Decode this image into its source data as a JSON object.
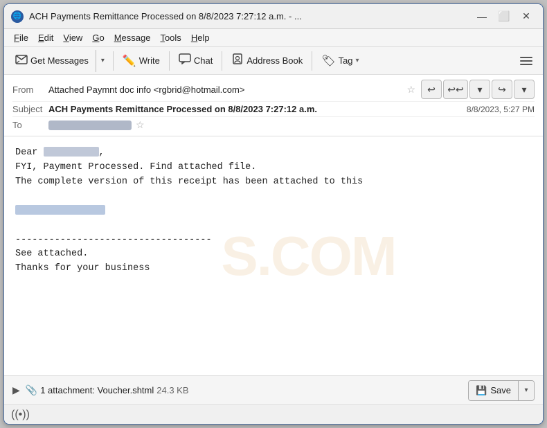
{
  "window": {
    "title": "ACH Payments Remittance Processed on 8/8/2023 7:27:12 a.m. - ...",
    "icon": "🌐"
  },
  "menu": {
    "items": [
      "File",
      "Edit",
      "View",
      "Go",
      "Message",
      "Tools",
      "Help"
    ],
    "underline_chars": [
      "F",
      "E",
      "V",
      "G",
      "M",
      "T",
      "H"
    ]
  },
  "toolbar": {
    "get_messages_label": "Get Messages",
    "write_label": "Write",
    "chat_label": "Chat",
    "address_book_label": "Address Book",
    "tag_label": "Tag"
  },
  "email": {
    "from_label": "From",
    "from_value": "Attached Paymnt doc info <rgbrid@hotmail.com>",
    "subject_label": "Subject",
    "subject_value": "ACH Payments Remittance Processed on 8/8/2023 7:27:12 a.m.",
    "date_value": "8/8/2023, 5:27 PM",
    "to_label": "To"
  },
  "body": {
    "line1": "Dear",
    "line2": "FYI, Payment Processed. Find attached file.",
    "line3": "The complete version of this receipt has been attached to this",
    "separator": "-----------------------------------",
    "line4": "See attached.",
    "line5": "Thanks for your business"
  },
  "attachment": {
    "count_text": "1 attachment: Voucher.shtml",
    "size": "24.3 KB",
    "save_label": "Save"
  },
  "status": {
    "icon": "((•))"
  }
}
